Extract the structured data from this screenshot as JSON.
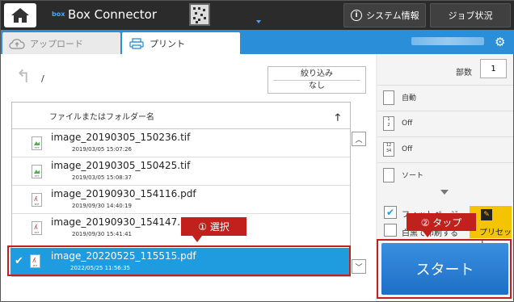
{
  "app": {
    "logo": "box",
    "title": "Box Connector"
  },
  "header": {
    "system_info_label": "システム情報",
    "job_status_label": "ジョブ状況"
  },
  "tabs": [
    {
      "label": "アップロード",
      "icon": "cloud-upload-icon"
    },
    {
      "label": "プリント",
      "icon": "printer-icon",
      "active": true
    }
  ],
  "browser": {
    "path": "/",
    "filter": {
      "title": "絞り込み",
      "value": "なし"
    },
    "column_header": "ファイルまたはフォルダー名",
    "files": [
      {
        "name": "image_20190305_150236.tif",
        "date": "2019/03/05 15:07:26",
        "type": "TIFF"
      },
      {
        "name": "image_20190305_150425.tif",
        "date": "2019/03/05 15:08:37",
        "type": "TIFF"
      },
      {
        "name": "image_20190930_154116.pdf",
        "date": "2019/09/30 14:40:19",
        "type": "PDF"
      },
      {
        "name": "image_20190930_154147.pdf",
        "date": "2019/09/30 15:41:41",
        "type": "PDF"
      }
    ],
    "selected_file": {
      "name": "image_20220525_115515.pdf",
      "date": "2022/05/25 11:56:35",
      "type": "PDF"
    }
  },
  "settings": {
    "copies_label": "部数",
    "copies_value": "1",
    "options": [
      {
        "label": "自動"
      },
      {
        "label": "Off"
      },
      {
        "label": "Off"
      },
      {
        "label": "ソート"
      }
    ],
    "fit_page_label": "フィットページ",
    "mono_label": "白黒で印刷する",
    "preset_label": "プリセット",
    "start_label": "スタート"
  },
  "annotations": {
    "select": "① 選択",
    "tap": "② タップ",
    "color": "#c1201d"
  }
}
